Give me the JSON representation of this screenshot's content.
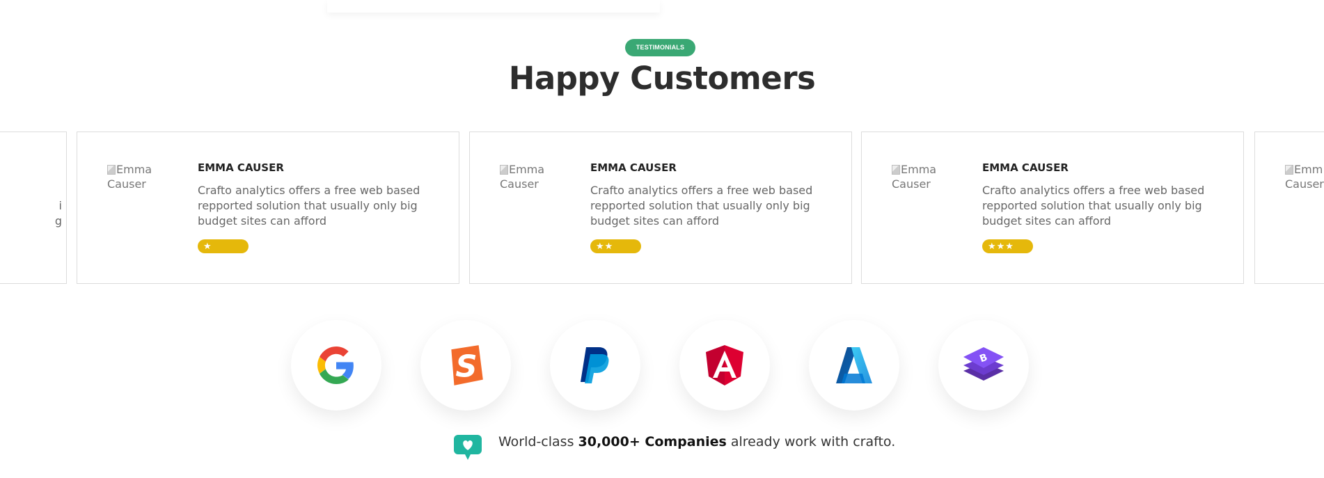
{
  "section": {
    "badge": "TESTIMONIALS",
    "title": "Happy Customers"
  },
  "testimonials": [
    {
      "avatar_alt_1": "Emma",
      "avatar_alt_2": "Causer",
      "name": "EMMA CAUSER",
      "text": "Crafto analytics offers a free web based repported solution that usually only big budget sites can afford",
      "rating": 1,
      "stars": "★"
    },
    {
      "avatar_alt_1": "Emma",
      "avatar_alt_2": "Causer",
      "name": "EMMA CAUSER",
      "text": "Crafto analytics offers a free web based repported solution that usually only big budget sites can afford",
      "rating": 2,
      "stars": "★★"
    },
    {
      "avatar_alt_1": "Emma",
      "avatar_alt_2": "Causer",
      "name": "EMMA CAUSER",
      "text": "Crafto analytics offers a free web based repported solution that usually only big budget sites can afford",
      "rating": 3,
      "stars": "★★★"
    }
  ],
  "partial_left": {
    "line1": "i",
    "line2": "g"
  },
  "partial_right": {
    "avatar_alt_1": "Emm",
    "avatar_alt_2": "Causer"
  },
  "logos": [
    "google-icon",
    "smashing-icon",
    "paypal-icon",
    "angular-icon",
    "azure-icon",
    "bootstrap-icon"
  ],
  "footer": {
    "prefix": "World-class ",
    "highlight": "30,000+ Companies",
    "suffix": " already work with crafto."
  },
  "colors": {
    "badge": "#3aa874",
    "stars": "#e5b80b"
  }
}
